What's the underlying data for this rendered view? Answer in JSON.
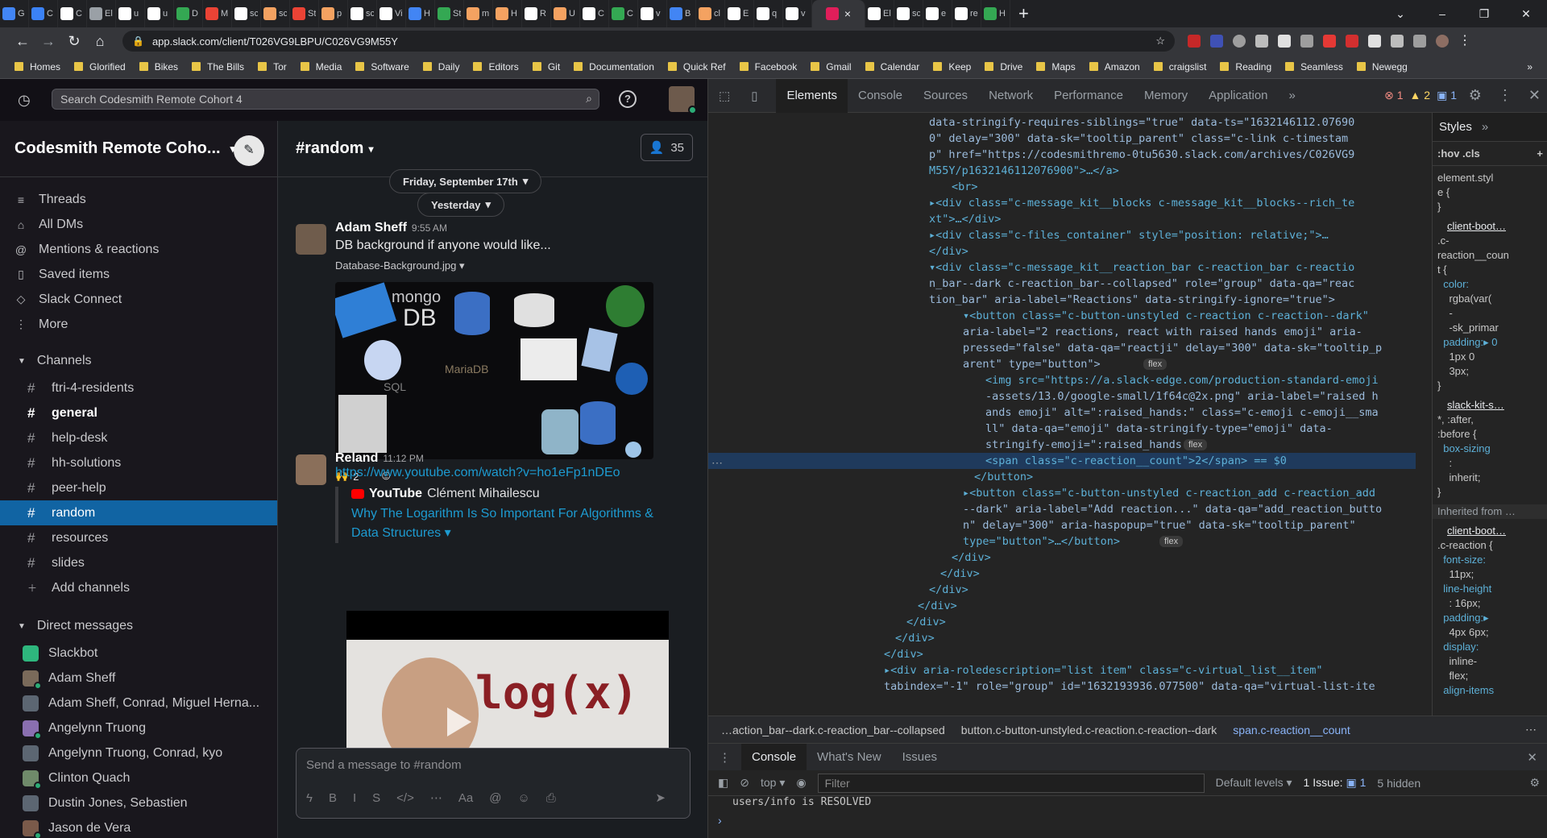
{
  "browser": {
    "tabs": [
      {
        "label": "G",
        "fav": "#4285f4"
      },
      {
        "label": "C",
        "fav": "#3b82f6"
      },
      {
        "label": "C",
        "fav": "#ffffff"
      },
      {
        "label": "El",
        "fav": "#9aa0a6"
      },
      {
        "label": "u",
        "fav": "#ffffff"
      },
      {
        "label": "u",
        "fav": "#ffffff"
      },
      {
        "label": "D",
        "fav": "#34a853"
      },
      {
        "label": "M",
        "fav": "#ea4335"
      },
      {
        "label": "sc",
        "fav": "#ffffff"
      },
      {
        "label": "sc",
        "fav": "#f4a261"
      },
      {
        "label": "St",
        "fav": "#ea4335"
      },
      {
        "label": "p",
        "fav": "#f4a261"
      },
      {
        "label": "sc",
        "fav": "#ffffff"
      },
      {
        "label": "Vi",
        "fav": "#ffffff"
      },
      {
        "label": "H",
        "fav": "#4285f4"
      },
      {
        "label": "St",
        "fav": "#34a853"
      },
      {
        "label": "m",
        "fav": "#f4a261"
      },
      {
        "label": "H",
        "fav": "#f4a261"
      },
      {
        "label": "R",
        "fav": "#ffffff"
      },
      {
        "label": "U",
        "fav": "#f4a261"
      },
      {
        "label": "C",
        "fav": "#ffffff"
      },
      {
        "label": "C",
        "fav": "#34a853"
      },
      {
        "label": "v",
        "fav": "#ffffff"
      },
      {
        "label": "B",
        "fav": "#4285f4"
      },
      {
        "label": "cl",
        "fav": "#f4a261"
      },
      {
        "label": "E",
        "fav": "#ffffff"
      },
      {
        "label": "q",
        "fav": "#ffffff"
      },
      {
        "label": "v",
        "fav": "#ffffff"
      }
    ],
    "active_tab": {
      "fav": "#e01e5a",
      "close": "×"
    },
    "more_tabs": [
      {
        "label": "El",
        "fav": "#ffffff"
      },
      {
        "label": "sc",
        "fav": "#ffffff"
      },
      {
        "label": "e",
        "fav": "#ffffff"
      },
      {
        "label": "re",
        "fav": "#ffffff"
      },
      {
        "label": "H",
        "fav": "#34a853"
      }
    ],
    "new_tab": "+",
    "window_controls": [
      "⌄",
      "–",
      "❐",
      "✕"
    ],
    "url": "app.slack.com/client/T026VG9LBPU/C026VG9M55Y",
    "bookmarks": [
      "Homes",
      "Glorified",
      "Bikes",
      "The Bills",
      "Tor",
      "Media",
      "Software",
      "Daily",
      "Editors",
      "Git",
      "Documentation",
      "Quick Ref",
      "Facebook",
      "Gmail",
      "Calendar",
      "Keep",
      "Drive",
      "Maps",
      "Amazon",
      "craigslist",
      "Reading",
      "Seamless",
      "Newegg"
    ],
    "bookmarks_more": "»"
  },
  "slack": {
    "search_placeholder": "Search Codesmith Remote Cohort 4",
    "help": "?",
    "workspace": "Codesmith Remote Coho...",
    "nav": [
      {
        "icon": "≡",
        "label": "Threads"
      },
      {
        "icon": "⌂",
        "label": "All DMs"
      },
      {
        "icon": "@",
        "label": "Mentions & reactions"
      },
      {
        "icon": "▯",
        "label": "Saved items"
      },
      {
        "icon": "◇",
        "label": "Slack Connect"
      },
      {
        "icon": "⋮",
        "label": "More"
      }
    ],
    "channels_header": "Channels",
    "channels": [
      {
        "name": "ftri-4-residents",
        "style": ""
      },
      {
        "name": "general",
        "style": "bold"
      },
      {
        "name": "help-desk",
        "style": ""
      },
      {
        "name": "hh-solutions",
        "style": ""
      },
      {
        "name": "peer-help",
        "style": ""
      },
      {
        "name": "random",
        "style": "sel"
      },
      {
        "name": "resources",
        "style": ""
      },
      {
        "name": "slides",
        "style": ""
      }
    ],
    "add_channels": "Add channels",
    "dm_header": "Direct messages",
    "dms": [
      {
        "name": "Slackbot",
        "color": "#2eb67d",
        "badge": false
      },
      {
        "name": "Adam Sheff",
        "color": "#7a6a5a",
        "badge": true
      },
      {
        "name": "Adam Sheff, Conrad, Miguel Herna...",
        "color": "#5c6672",
        "badge": false
      },
      {
        "name": "Angelynn Truong",
        "color": "#8a6fb0",
        "badge": true
      },
      {
        "name": "Angelynn Truong, Conrad, kyo",
        "color": "#5c6672",
        "badge": false
      },
      {
        "name": "Clinton Quach",
        "color": "#6f8a6a",
        "badge": true
      },
      {
        "name": "Dustin Jones, Sebastien",
        "color": "#5c6672",
        "badge": false
      },
      {
        "name": "Jason de Vera",
        "color": "#7a5a4a",
        "badge": true
      },
      {
        "name": "Jillian Brinberg",
        "color": "#9a7a6a",
        "badge": false
      }
    ],
    "channel": {
      "name": "#random",
      "members": "35",
      "date_pill_1": "Friday, September 17th",
      "date_pill_2": "Yesterday",
      "messages": [
        {
          "author": "Adam Sheff",
          "time": "9:55 AM",
          "text": "DB background if anyone would like...",
          "file": "Database-Background.jpg",
          "reaction_emoji": "🙌",
          "reaction_count": "2"
        },
        {
          "author": "Reland",
          "time": "11:12 PM",
          "link": "https://www.youtube.com/watch?v=ho1eFp1nDEo",
          "embed_source": "YouTube",
          "embed_author": "Clément Mihailescu",
          "embed_title": "Why The Logarithm Is So Important For Algorithms & Data Structures",
          "thumb_text": "log(x)"
        }
      ],
      "composer_placeholder": "Send a message to #random",
      "composer_tools": [
        "ϟ",
        "B",
        "I",
        "S",
        "</>",
        "⋯",
        "Aa",
        "@",
        "☺",
        "⎙"
      ],
      "send_icon": "➤"
    },
    "db_image_text": {
      "mongo": "mongo",
      "db": "DB",
      "mariadb": "MariaDB",
      "sql": "SQL"
    }
  },
  "devtools": {
    "tabs": [
      "Elements",
      "Console",
      "Sources",
      "Network",
      "Performance",
      "Memory",
      "Application"
    ],
    "active_tab": "Elements",
    "more": "»",
    "errors": "1",
    "warnings": "2",
    "messages": "1",
    "dom_lines": [
      "data-stringify-requires-siblings=\"true\" data-ts=\"1632146112.07690",
      "0\" delay=\"300\" data-sk=\"tooltip_parent\" class=\"c-link c-timestam",
      "p\" href=\"https://codesmithremo-0tu5630.slack.com/archives/C026VG9",
      "M55Y/p1632146112076900\">…</a>",
      "<br>",
      "▸<div class=\"c-message_kit__blocks c-message_kit__blocks--rich_te",
      "xt\">…</div>",
      "▸<div class=\"c-files_container\" style=\"position: relative;\">…",
      "</div>",
      "▾<div class=\"c-message_kit__reaction_bar c-reaction_bar c-reactio",
      "n_bar--dark c-reaction_bar--collapsed\" role=\"group\" data-qa=\"reac",
      "tion_bar\" aria-label=\"Reactions\" data-stringify-ignore=\"true\">",
      "▾<button class=\"c-button-unstyled c-reaction c-reaction--dark\"",
      "aria-label=\"2 reactions, react with raised hands emoji\" aria-",
      "pressed=\"false\" data-qa=\"reactji\" delay=\"300\" data-sk=\"tooltip_p",
      "arent\" type=\"button\">",
      "<img src=\"https://a.slack-edge.com/production-standard-emoji",
      "-assets/13.0/google-small/1f64c@2x.png\" aria-label=\"raised h",
      "ands emoji\" alt=\":raised_hands:\" class=\"c-emoji c-emoji__sma",
      "ll\" data-qa=\"emoji\" data-stringify-type=\"emoji\" data-",
      "stringify-emoji=\":raised_hands:\">",
      "<span class=\"c-reaction__count\">2</span> == $0",
      "</button>",
      "▸<button class=\"c-button-unstyled c-reaction_add c-reaction_add",
      "--dark\" aria-label=\"Add reaction...\" data-qa=\"add_reaction_butto",
      "n\" delay=\"300\" aria-haspopup=\"true\" data-sk=\"tooltip_parent\"",
      "type=\"button\">…</button>",
      "</div>",
      "</div>",
      "</div>",
      "</div>",
      "</div>",
      "</div>",
      "</div>",
      "▸<div aria-roledescription=\"list item\" class=\"c-virtual_list__item\"",
      "tabindex=\"-1\" role=\"group\" id=\"1632193936.077500\" data-qa=\"virtual-list-ite"
    ],
    "flex_badge": "flex",
    "gutter_dots": "⋯",
    "styles_tab": "Styles",
    "styles_more": "»",
    "styles_filter": ":hov .cls",
    "styles_add": "+",
    "style_rules": [
      "element.styl",
      "e {",
      "}",
      "client-boot…",
      ".c-",
      "reaction__coun",
      "t {",
      "  color:",
      "    rgba(var(",
      "    -",
      "    -sk_primar",
      "  padding:▸ 0",
      "    1px 0",
      "    3px;",
      "}",
      "slack-kit-s…",
      "*, :after,",
      ":before {",
      "  box-sizing",
      "    :",
      "    inherit;",
      "}",
      "Inherited from …",
      "client-boot…",
      ".c-reaction {",
      "  font-size:",
      "    11px;",
      "  line-height",
      "    : 16px;",
      "  padding:▸",
      "    4px 6px;",
      "  display:",
      "    inline-",
      "    flex;",
      "  align-items"
    ],
    "breadcrumbs": [
      "…action_bar--dark.c-reaction_bar--collapsed",
      "button.c-button-unstyled.c-reaction.c-reaction--dark",
      "span.c-reaction__count"
    ],
    "breadcrumbs_more": "⋯",
    "drawer_tabs": [
      "Console",
      "What's New",
      "Issues"
    ],
    "drawer_close": "✕",
    "context": "top",
    "filter_placeholder": "Filter",
    "levels": "Default levels",
    "issues": "1 Issue:",
    "issues_count": "1",
    "hidden": "5 hidden",
    "console_line": "users/info is RESOLVED",
    "prompt": "›"
  }
}
